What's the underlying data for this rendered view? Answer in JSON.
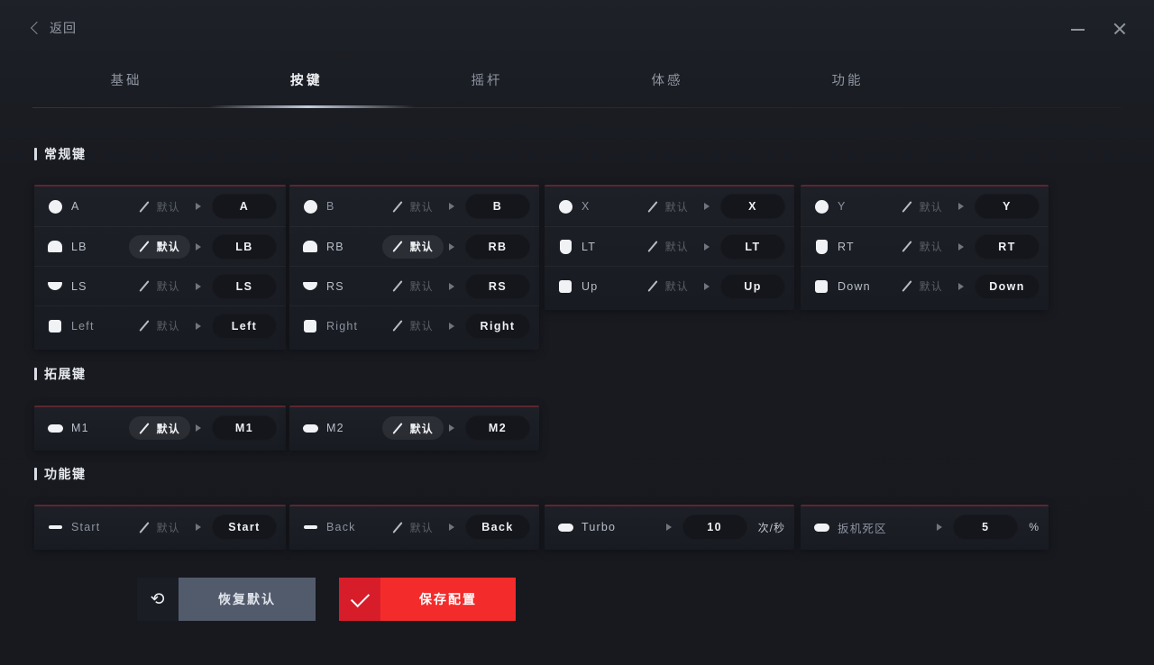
{
  "window": {
    "back_label": "返回",
    "minimize_icon": "minimize-icon",
    "close_icon": "close-icon"
  },
  "tabs": [
    {
      "label": "基础",
      "active": false
    },
    {
      "label": "按键",
      "active": true
    },
    {
      "label": "摇杆",
      "active": false
    },
    {
      "label": "体感",
      "active": false
    },
    {
      "label": "功能",
      "active": false
    }
  ],
  "sections": [
    {
      "title": "常规键"
    },
    {
      "title": "拓展键"
    },
    {
      "title": "功能键"
    }
  ],
  "labels": {
    "default_text": "默认"
  },
  "regular_keys": [
    [
      {
        "icon": "circle-button-icon",
        "label": "A",
        "mode": "默认",
        "mode_active": false,
        "value": "A"
      },
      {
        "icon": "shoulder-left-icon",
        "label": "LB",
        "mode": "默认",
        "mode_active": true,
        "value": "LB"
      },
      {
        "icon": "stick-icon",
        "label": "LS",
        "mode": "默认",
        "mode_active": false,
        "value": "LS"
      },
      {
        "icon": "dpad-left-icon",
        "label": "Left",
        "mode": "默认",
        "mode_active": false,
        "value": "Left"
      }
    ],
    [
      {
        "icon": "circle-button-icon",
        "label": "B",
        "mode": "默认",
        "mode_active": false,
        "value": "B"
      },
      {
        "icon": "shoulder-right-icon",
        "label": "RB",
        "mode": "默认",
        "mode_active": true,
        "value": "RB"
      },
      {
        "icon": "stick-icon",
        "label": "RS",
        "mode": "默认",
        "mode_active": false,
        "value": "RS"
      },
      {
        "icon": "dpad-right-icon",
        "label": "Right",
        "mode": "默认",
        "mode_active": false,
        "value": "Right"
      }
    ],
    [
      {
        "icon": "circle-button-icon",
        "label": "X",
        "mode": "默认",
        "mode_active": false,
        "value": "X"
      },
      {
        "icon": "trigger-left-icon",
        "label": "LT",
        "mode": "默认",
        "mode_active": false,
        "value": "LT"
      },
      {
        "icon": "dpad-up-icon",
        "label": "Up",
        "mode": "默认",
        "mode_active": false,
        "value": "Up"
      }
    ],
    [
      {
        "icon": "circle-button-icon",
        "label": "Y",
        "mode": "默认",
        "mode_active": false,
        "value": "Y"
      },
      {
        "icon": "trigger-right-icon",
        "label": "RT",
        "mode": "默认",
        "mode_active": false,
        "value": "RT"
      },
      {
        "icon": "dpad-down-icon",
        "label": "Down",
        "mode": "默认",
        "mode_active": false,
        "value": "Down"
      }
    ]
  ],
  "extension_keys": [
    {
      "icon": "macro-key-icon",
      "label": "M1",
      "mode": "默认",
      "mode_active": true,
      "value": "M1"
    },
    {
      "icon": "macro-key-icon",
      "label": "M2",
      "mode": "默认",
      "mode_active": true,
      "value": "M2"
    }
  ],
  "function_keys": [
    {
      "icon": "start-button-icon",
      "label": "Start",
      "mode": "默认",
      "mode_active": false,
      "value": "Start",
      "unit": ""
    },
    {
      "icon": "back-button-icon",
      "label": "Back",
      "mode": "默认",
      "mode_active": false,
      "value": "Back",
      "unit": ""
    },
    {
      "icon": "turbo-icon",
      "label": "Turbo",
      "mode": "",
      "mode_active": false,
      "value": "10",
      "unit": "次/秒"
    },
    {
      "icon": "trigger-deadzone-icon",
      "label": "扳机死区",
      "mode": "",
      "mode_active": false,
      "value": "5",
      "unit": "%"
    }
  ],
  "footer": {
    "reset_icon": "undo-icon",
    "reset_label": "恢复默认",
    "save_icon": "check-icon",
    "save_label": "保存配置"
  },
  "colors": {
    "accent_red": "#f32b2b",
    "accent_red_dark": "#d81d2a",
    "card_border_top": "#5d2630",
    "grey_button": "#525b6b",
    "background": "#1c1f26"
  }
}
